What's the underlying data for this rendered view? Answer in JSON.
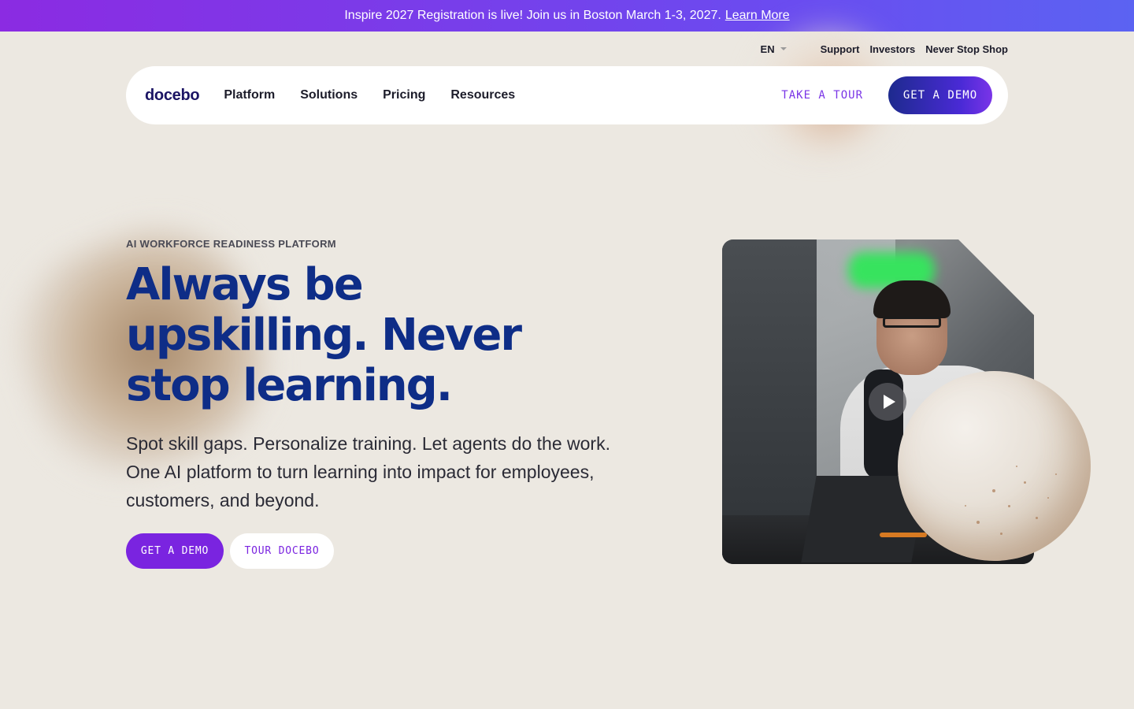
{
  "announcement": {
    "text": "Inspire 2027 Registration is live! Join us in Boston March 1-3, 2027.",
    "link_label": "Learn More"
  },
  "utility_nav": {
    "language": "EN",
    "links": [
      "Support",
      "Investors",
      "Never Stop Shop"
    ]
  },
  "navbar": {
    "logo": "docebo",
    "items": [
      "Platform",
      "Solutions",
      "Pricing",
      "Resources"
    ],
    "take_tour_label": "TAKE A TOUR",
    "demo_label": "GET A DEMO"
  },
  "hero": {
    "eyebrow": "AI WORKFORCE READINESS PLATFORM",
    "headline": "Always be upskilling. Never stop learning.",
    "subcopy": "Spot skill gaps. Personalize training. Let agents do the work. One AI platform to turn learning into impact for employees, customers, and beyond.",
    "primary_cta": "GET A DEMO",
    "secondary_cta": "TOUR DOCEBO"
  },
  "media": {
    "play_icon": "play-icon"
  },
  "colors": {
    "announcement_start": "#8b2be2",
    "announcement_end": "#5b63f2",
    "headline": "#0e2d87",
    "accent_purple": "#7a24e0",
    "navy": "#1d2a8e",
    "background": "#ece8e1"
  }
}
